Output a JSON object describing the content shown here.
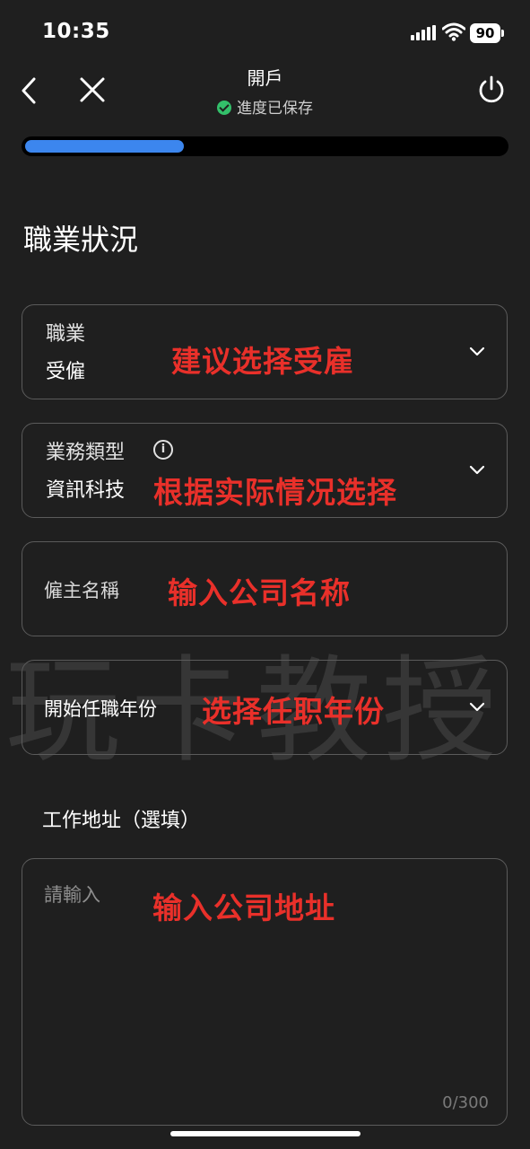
{
  "status_bar": {
    "time": "10:35",
    "battery": "90"
  },
  "nav": {
    "title": "開戶",
    "saved_status": "進度已保存"
  },
  "progress": {
    "fraction": 0.33
  },
  "section": {
    "title": "職業狀況"
  },
  "fields": {
    "occupation": {
      "label": "職業",
      "value": "受僱",
      "note": "建议选择受雇"
    },
    "business_type": {
      "label": "業務類型",
      "value": "資訊科技",
      "note": "根据实际情况选择"
    },
    "employer_name": {
      "placeholder": "僱主名稱",
      "note": "输入公司名称"
    },
    "start_year": {
      "placeholder": "開始任職年份",
      "note": "选择任职年份"
    },
    "work_address": {
      "label": "工作地址（選填）",
      "placeholder": "請輸入",
      "note": "输入公司地址",
      "counter": "0/300"
    }
  },
  "watermark": "玩卡教授",
  "colors": {
    "accent": "#3c86ee",
    "success": "#33c06a",
    "annotation": "#e9302a",
    "background": "#1f1f1f"
  },
  "icons": [
    "back-icon",
    "close-icon",
    "power-icon",
    "check-circle-icon",
    "info-icon",
    "chevron-down-icon"
  ]
}
